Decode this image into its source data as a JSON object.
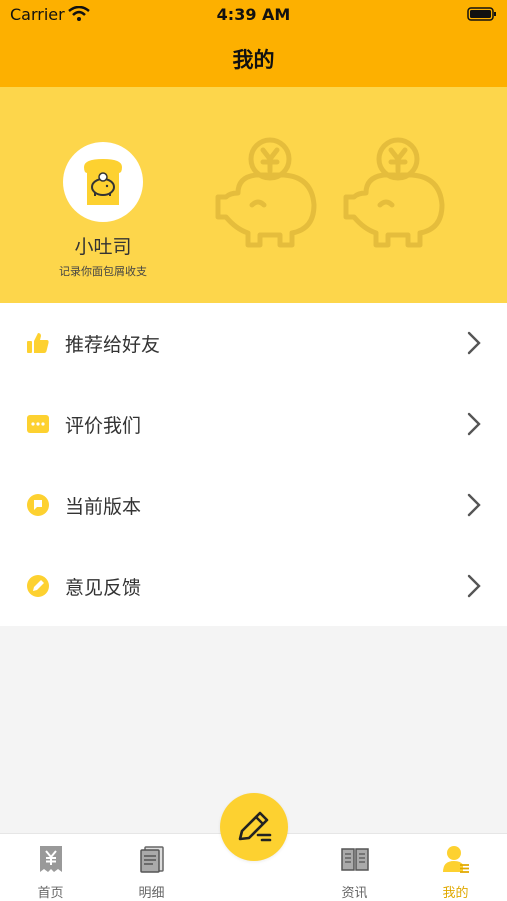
{
  "status_bar": {
    "carrier": "Carrier",
    "time": "4:39 AM"
  },
  "nav": {
    "title": "我的"
  },
  "profile": {
    "name": "小吐司",
    "slogan": "记录你面包屑收支"
  },
  "menu": {
    "items": [
      {
        "label": "推荐给好友",
        "icon": "thumbs-up-icon"
      },
      {
        "label": "评价我们",
        "icon": "chat-dots-icon"
      },
      {
        "label": "当前版本",
        "icon": "flag-icon"
      },
      {
        "label": "意见反馈",
        "icon": "pencil-icon"
      }
    ]
  },
  "tabs": [
    {
      "label": "首页",
      "icon": "receipt-yen-icon"
    },
    {
      "label": "明细",
      "icon": "document-icon"
    },
    {
      "label": "资讯",
      "icon": "book-icon"
    },
    {
      "label": "我的",
      "icon": "user-icon",
      "active": true
    }
  ],
  "colors": {
    "nav": "#fdb000",
    "header": "#fdd64b",
    "accent": "#fdd130",
    "active_tab": "#e0a800"
  }
}
